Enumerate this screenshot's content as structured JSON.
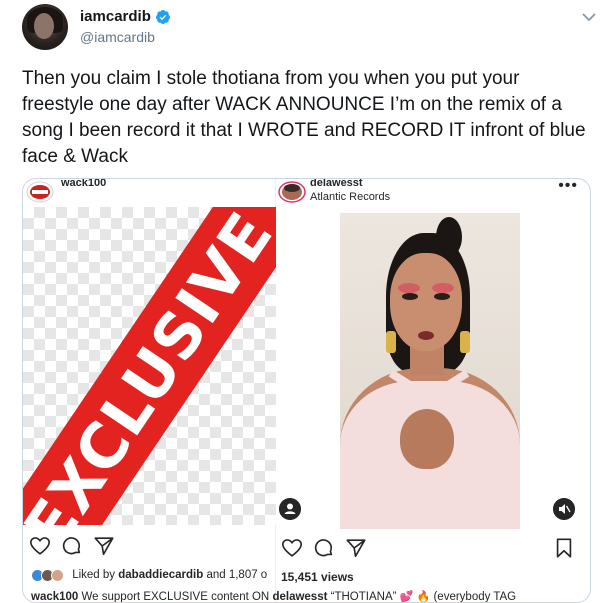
{
  "tweet": {
    "display_name": "iamcardib",
    "handle": "@iamcardib",
    "verified": true,
    "text": "Then you claim I stole thotiana from you when you put your freestyle one day after WACK ANNOUNCE I’m on the remix of a song I been record it that I WROTE and RECORD IT infront of blue face & Wack"
  },
  "media": {
    "left_post": {
      "username": "wack100",
      "image_text": "EXCLUSIVE"
    },
    "right_post": {
      "username": "delawesst",
      "subtitle": "Atlantic Records",
      "more_icon": "more-horizontal-icon"
    },
    "actions": {
      "left": [
        "heart-icon",
        "comment-icon",
        "share-icon"
      ],
      "right": [
        "heart-icon",
        "comment-icon",
        "share-icon",
        "bookmark-icon"
      ]
    },
    "likes_text_prefix": "Liked by",
    "likes_user": "dabaddiecardib",
    "likes_suffix": "and 1,807 o",
    "views": "15,451 views",
    "caption_user": "wack100",
    "caption_text": "We support EXCLUSIVE content ON",
    "caption_mention": "delawesst",
    "caption_song": "“THOTIANA”",
    "caption_tail": "(everybody TAG"
  },
  "colors": {
    "verified": "#1da1f2",
    "exclusive_red": "#e32320",
    "handle_gray": "#657786"
  }
}
